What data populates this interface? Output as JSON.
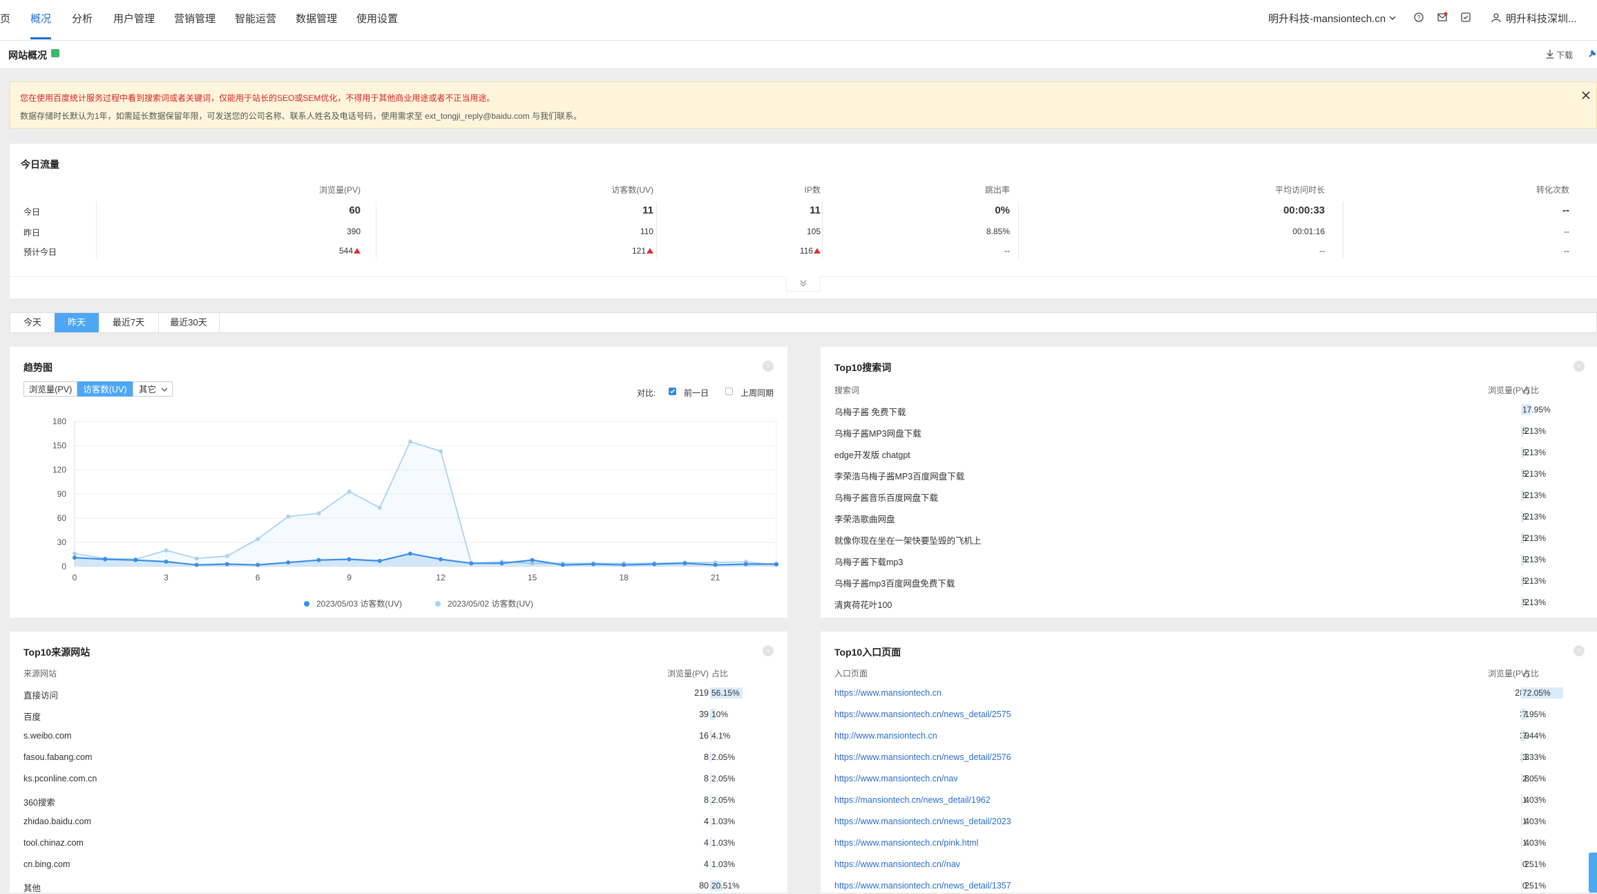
{
  "nav": {
    "items": [
      "页",
      "概况",
      "分析",
      "用户管理",
      "营销管理",
      "智能运营",
      "数据管理",
      "使用设置"
    ],
    "active": "概况",
    "site_selector": "明升科技-mansiontech.cn",
    "account": "明升科技深圳..."
  },
  "page": {
    "title": "网站概况",
    "download_label": "下载"
  },
  "notice": {
    "line1": "您在使用百度统计服务过程中看到搜索词或者关键词，仅能用于站长的SEO或SEM优化，不得用于其他商业用途或者不正当用途。",
    "line2": "数据存储时长默认为1年，如需延长数据保留年限，可发送您的公司名称、联系人姓名及电话号码，使用需求至 ext_tongji_reply@baidu.com 与我们联系。"
  },
  "today_traffic": {
    "title": "今日流量",
    "columns": [
      "浏览量(PV)",
      "访客数(UV)",
      "IP数",
      "跳出率",
      "平均访问时长",
      "转化次数"
    ],
    "rows": [
      {
        "label": "今日",
        "values": [
          "60",
          "11",
          "11",
          "0%",
          "00:00:33",
          "--"
        ]
      },
      {
        "label": "昨日",
        "values": [
          "390",
          "110",
          "105",
          "8.85%",
          "00:01:16",
          "--"
        ]
      },
      {
        "label": "预计今日",
        "values": [
          "544",
          "121",
          "116",
          "--",
          "--",
          "--"
        ]
      }
    ]
  },
  "period_tabs": [
    "今天",
    "昨天",
    "最近7天",
    "最近30天"
  ],
  "period_active": "昨天",
  "trend": {
    "title": "趋势图",
    "metric_tabs": [
      "浏览量(PV)",
      "访客数(UV)",
      "其它"
    ],
    "metric_active": "访客数(UV)",
    "compare_label": "对比:",
    "compare_options": [
      {
        "label": "前一日",
        "checked": true
      },
      {
        "label": "上周同期",
        "checked": false
      }
    ]
  },
  "chart_data": {
    "type": "area",
    "x": [
      0,
      1,
      2,
      3,
      4,
      5,
      6,
      7,
      8,
      9,
      10,
      11,
      12,
      13,
      14,
      15,
      16,
      17,
      18,
      19,
      20,
      21,
      22,
      23
    ],
    "x_ticks": [
      0,
      3,
      6,
      9,
      12,
      15,
      18,
      21
    ],
    "y_ticks": [
      0,
      30,
      60,
      90,
      120,
      150,
      180
    ],
    "ylim": [
      0,
      180
    ],
    "grid": true,
    "legend_position": "bottom",
    "series": [
      {
        "name": "2023/05/03 访客数(UV)",
        "color": "#3a8ee6",
        "values": [
          11,
          9,
          8,
          6,
          2,
          3,
          2,
          5,
          8,
          9,
          7,
          16,
          9,
          4,
          4,
          8,
          2,
          3,
          2,
          3,
          4,
          2,
          3,
          3
        ]
      },
      {
        "name": "2023/05/02 访客数(UV)",
        "color": "#a9d3f5",
        "values": [
          16,
          10,
          9,
          20,
          10,
          13,
          34,
          62,
          66,
          93,
          73,
          155,
          143,
          4,
          6,
          4,
          4,
          4,
          4,
          4,
          5,
          5,
          6,
          2
        ]
      }
    ]
  },
  "top_keywords": {
    "title": "Top10搜索词",
    "headers": [
      "搜索词",
      "浏览量(PV)",
      "占比"
    ],
    "rows": [
      {
        "name": "乌梅子酱 免费下载",
        "pv": "7",
        "pct": "17.95%",
        "ratio": 0.1795
      },
      {
        "name": "乌梅子酱MP3网盘下载",
        "pv": "2",
        "pct": "5.13%",
        "ratio": 0.0513
      },
      {
        "name": "edge开发版 chatgpt",
        "pv": "2",
        "pct": "5.13%",
        "ratio": 0.0513
      },
      {
        "name": "李荣浩乌梅子酱MP3百度网盘下载",
        "pv": "2",
        "pct": "5.13%",
        "ratio": 0.0513
      },
      {
        "name": "乌梅子酱音乐百度网盘下载",
        "pv": "2",
        "pct": "5.13%",
        "ratio": 0.0513
      },
      {
        "name": "李荣浩歌曲网盘",
        "pv": "2",
        "pct": "5.13%",
        "ratio": 0.0513
      },
      {
        "name": "就像你现在坐在一架快要坠毁的飞机上",
        "pv": "2",
        "pct": "5.13%",
        "ratio": 0.0513
      },
      {
        "name": "乌梅子酱下载mp3",
        "pv": "2",
        "pct": "5.13%",
        "ratio": 0.0513
      },
      {
        "name": "乌梅子酱mp3百度网盘免费下载",
        "pv": "2",
        "pct": "5.13%",
        "ratio": 0.0513
      },
      {
        "name": "清爽荷花叶100",
        "pv": "2",
        "pct": "5.13%",
        "ratio": 0.0513
      }
    ]
  },
  "top_sources": {
    "title": "Top10来源网站",
    "headers": [
      "来源网站",
      "浏览量(PV)",
      "占比"
    ],
    "rows": [
      {
        "name": "直接访问",
        "pv": "219",
        "pct": "56.15%",
        "ratio": 0.5615
      },
      {
        "name": "百度",
        "pv": "39",
        "pct": "10%",
        "ratio": 0.1
      },
      {
        "name": "s.weibo.com",
        "pv": "16",
        "pct": "4.1%",
        "ratio": 0.041
      },
      {
        "name": "fasou.fabang.com",
        "pv": "8",
        "pct": "2.05%",
        "ratio": 0.0205
      },
      {
        "name": "ks.pconline.com.cn",
        "pv": "8",
        "pct": "2.05%",
        "ratio": 0.0205
      },
      {
        "name": "360搜索",
        "pv": "8",
        "pct": "2.05%",
        "ratio": 0.0205
      },
      {
        "name": "zhidao.baidu.com",
        "pv": "4",
        "pct": "1.03%",
        "ratio": 0.0103
      },
      {
        "name": "tool.chinaz.com",
        "pv": "4",
        "pct": "1.03%",
        "ratio": 0.0103
      },
      {
        "name": "cn.bing.com",
        "pv": "4",
        "pct": "1.03%",
        "ratio": 0.0103
      },
      {
        "name": "其他",
        "pv": "80",
        "pct": "20.51%",
        "ratio": 0.2051
      }
    ]
  },
  "top_entry_pages": {
    "title": "Top10入口页面",
    "headers": [
      "入口页面",
      "浏览量(PV)",
      "占比"
    ],
    "rows": [
      {
        "name": "https://www.mansiontech.cn",
        "pv": "281",
        "pct": "72.05%",
        "ratio": 0.7205
      },
      {
        "name": "https://www.mansiontech.cn/news_detail/2575",
        "pv": "31",
        "pct": "7.95%",
        "ratio": 0.0795
      },
      {
        "name": "http://www.mansiontech.cn",
        "pv": "29",
        "pct": "7.44%",
        "ratio": 0.0744
      },
      {
        "name": "https://www.mansiontech.cn/news_detail/2576",
        "pv": "13",
        "pct": "3.33%",
        "ratio": 0.0333
      },
      {
        "name": "https://www.mansiontech.cn/nav",
        "pv": "8",
        "pct": "2.05%",
        "ratio": 0.0205
      },
      {
        "name": "https://mansiontech.cn/news_detail/1962",
        "pv": "4",
        "pct": "1.03%",
        "ratio": 0.0103
      },
      {
        "name": "https://www.mansiontech.cn/news_detail/2023",
        "pv": "4",
        "pct": "1.03%",
        "ratio": 0.0103
      },
      {
        "name": "https://www.mansiontech.cn/pink.html",
        "pv": "4",
        "pct": "1.03%",
        "ratio": 0.0103
      },
      {
        "name": "https://www.mansiontech.cn//nav",
        "pv": "2",
        "pct": "0.51%",
        "ratio": 0.0051
      },
      {
        "name": "https://www.mansiontech.cn/news_detail/1357",
        "pv": "2",
        "pct": "0.51%",
        "ratio": 0.0051
      }
    ]
  },
  "colors": {
    "accent": "#1f6fd6",
    "tab_active": "#4ea7f5",
    "up_arrow": "#e02f2f",
    "notice_bg": "#fdf6dc",
    "notice_text": "#e02020"
  }
}
